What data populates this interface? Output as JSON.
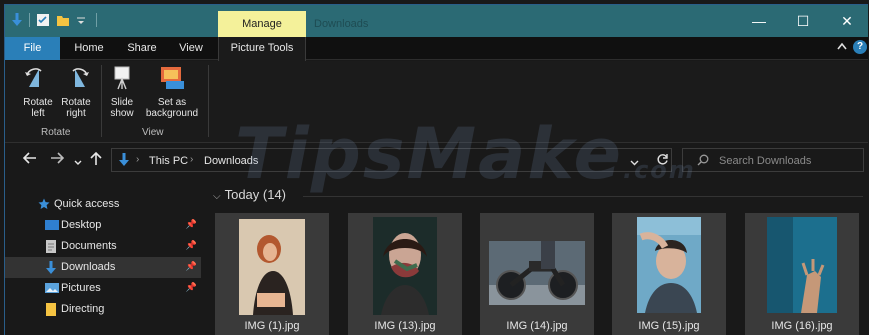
{
  "window": {
    "title": "Downloads",
    "context_tab": "Manage",
    "controls": {
      "minimize": "—",
      "maximize": "☐",
      "close": "✕"
    }
  },
  "ribbon_tabs": [
    "File",
    "Home",
    "Share",
    "View",
    "Picture Tools"
  ],
  "ribbon": {
    "rotate_left": "Rotate left",
    "rotate_right": "Rotate right",
    "slide_show": "Slide show",
    "set_background": "Set as background",
    "group_rotate": "Rotate",
    "group_view": "View"
  },
  "address": {
    "crumbs": [
      "This PC",
      "Downloads"
    ]
  },
  "search": {
    "placeholder": "Search Downloads"
  },
  "sidebar": {
    "items": [
      {
        "label": "Quick access",
        "icon": "star-icon"
      },
      {
        "label": "Desktop",
        "icon": "desktop-icon",
        "pinned": true
      },
      {
        "label": "Documents",
        "icon": "documents-icon",
        "pinned": true
      },
      {
        "label": "Downloads",
        "icon": "download-icon",
        "pinned": true,
        "selected": true
      },
      {
        "label": "Pictures",
        "icon": "pictures-icon",
        "pinned": true
      },
      {
        "label": "Directing",
        "icon": "folder-icon"
      }
    ]
  },
  "content": {
    "group_title": "Today (14)",
    "files": [
      {
        "name": "IMG (1).jpg"
      },
      {
        "name": "IMG (13).jpg"
      },
      {
        "name": "IMG (14).jpg"
      },
      {
        "name": "IMG (15).jpg"
      },
      {
        "name": "IMG (16).jpg"
      }
    ]
  },
  "watermark": {
    "text": "TipsMake",
    "suffix": ".com"
  },
  "colors": {
    "titlebar": "#2b6a74",
    "manage_tab": "#f4f19a",
    "file_tab": "#2a7fb8",
    "accent_blue": "#3a8fd9"
  }
}
